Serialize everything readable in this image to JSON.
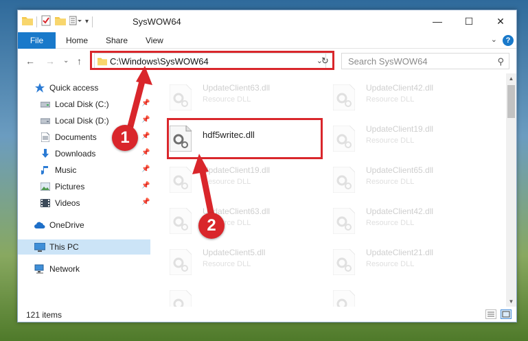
{
  "window": {
    "title": "SysWOW64",
    "controls": {
      "minimize": "—",
      "maximize": "☐",
      "close": "✕"
    }
  },
  "ribbon": {
    "tabs": [
      "File",
      "Home",
      "Share",
      "View"
    ],
    "help": "?"
  },
  "address": {
    "path": "C:\\Windows\\SysWOW64",
    "refresh_glyph": "↻"
  },
  "search": {
    "placeholder": "Search SysWOW64"
  },
  "sidebar": {
    "items": [
      {
        "label": "Quick access",
        "icon": "star-icon",
        "pinned": false
      },
      {
        "label": "Local Disk (C:)",
        "icon": "drive-icon",
        "pinned": true
      },
      {
        "label": "Local Disk (D:)",
        "icon": "drive-icon",
        "pinned": true
      },
      {
        "label": "Documents",
        "icon": "documents-icon",
        "pinned": true
      },
      {
        "label": "Downloads",
        "icon": "download-icon",
        "pinned": true
      },
      {
        "label": "Music",
        "icon": "music-icon",
        "pinned": true
      },
      {
        "label": "Pictures",
        "icon": "pictures-icon",
        "pinned": true
      },
      {
        "label": "Videos",
        "icon": "videos-icon",
        "pinned": true
      },
      {
        "label": "OneDrive",
        "icon": "cloud-icon",
        "pinned": false
      },
      {
        "label": "This PC",
        "icon": "computer-icon",
        "pinned": false,
        "selected": true
      },
      {
        "label": "Network",
        "icon": "network-icon",
        "pinned": false
      }
    ]
  },
  "files": {
    "type_label": "Resource DLL",
    "highlighted": {
      "name": "hdf5writec.dll"
    },
    "left_column": [
      "UpdateClient63.dll",
      "UpdateClient19.dll",
      "UpdateClient63.dll",
      "UpdateClient5.dll"
    ],
    "right_column": [
      "UpdateClient42.dll",
      "UpdateClient19.dll",
      "UpdateClient65.dll",
      "UpdateClient42.dll",
      "UpdateClient21.dll"
    ]
  },
  "status": {
    "item_count": "121 items"
  },
  "annotations": {
    "callout_1": "1",
    "callout_2": "2"
  },
  "colors": {
    "accent": "#1979ca",
    "highlight": "#d9262b",
    "selection": "#cce4f7"
  }
}
